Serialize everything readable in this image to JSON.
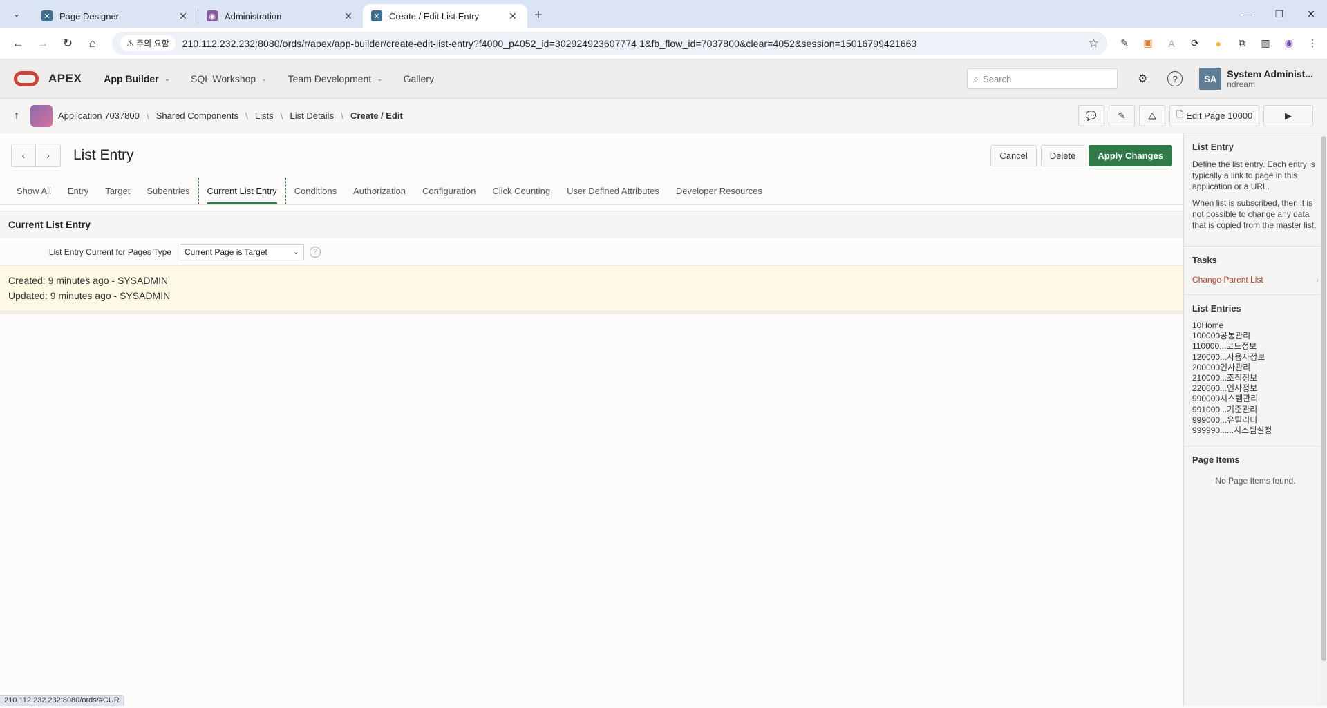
{
  "browser": {
    "tabs": [
      {
        "label": "Page Designer"
      },
      {
        "label": "Administration"
      },
      {
        "label": "Create / Edit List Entry"
      }
    ],
    "address": {
      "warning": "⚠ 주의 요함",
      "url": "210.112.232.232:8080/ords/r/apex/app-builder/create-edit-list-entry?f4000_p4052_id=302924923607774 1&fb_flow_id=7037800&clear=4052&session=15016799421663"
    }
  },
  "apex_header": {
    "brand": "APEX",
    "menu": [
      {
        "label": "App Builder"
      },
      {
        "label": "SQL Workshop"
      },
      {
        "label": "Team Development"
      },
      {
        "label": "Gallery"
      }
    ],
    "search_placeholder": "Search",
    "user_initials": "SA",
    "user_name": "System Administ...",
    "user_workspace": "ndream"
  },
  "breadcrumb": {
    "items": [
      {
        "label": "Application 7037800"
      },
      {
        "label": "Shared Components"
      },
      {
        "label": "Lists"
      },
      {
        "label": "List Details"
      },
      {
        "label": "Create / Edit"
      }
    ],
    "edit_page_label": "Edit Page 10000"
  },
  "page": {
    "title": "List Entry",
    "buttons": {
      "cancel": "Cancel",
      "delete": "Delete",
      "apply": "Apply Changes"
    },
    "tabs": [
      {
        "label": "Show All"
      },
      {
        "label": "Entry"
      },
      {
        "label": "Target"
      },
      {
        "label": "Subentries"
      },
      {
        "label": "Current List Entry"
      },
      {
        "label": "Conditions"
      },
      {
        "label": "Authorization"
      },
      {
        "label": "Configuration"
      },
      {
        "label": "Click Counting"
      },
      {
        "label": "User Defined Attributes"
      },
      {
        "label": "Developer Resources"
      }
    ],
    "region_title": "Current List Entry",
    "field_label": "List Entry Current for Pages Type",
    "field_value": "Current Page is Target",
    "created": "Created: 9 minutes ago - SYSADMIN",
    "updated": "Updated: 9 minutes ago - SYSADMIN",
    "status_url": "210.112.232.232:8080/ords/#CUR"
  },
  "sidebar": {
    "help_title": "List Entry",
    "help_p1": "Define the list entry. Each entry is typically a link to page in this application or a URL.",
    "help_p2": "When list is subscribed, then it is not possible to change any data that is copied from the master list.",
    "tasks_title": "Tasks",
    "task_change_parent": "Change Parent List",
    "entries_title": "List Entries",
    "entries": [
      "10Home",
      "100000공통관리",
      "110000...코드정보",
      "120000...사용자정보",
      "200000인사관리",
      "210000...조직정보",
      "220000...인사정보",
      "990000시스템관리",
      "991000...기준관리",
      "999000...유틸리티",
      "999990......시스템설정"
    ],
    "page_items_title": "Page Items",
    "no_page_items": "No Page Items found."
  }
}
